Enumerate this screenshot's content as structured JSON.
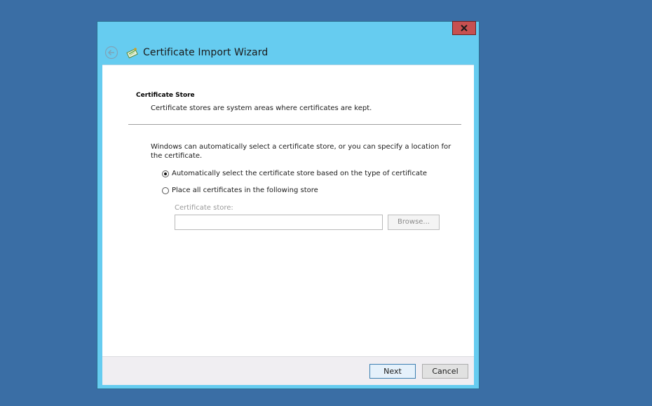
{
  "window": {
    "title": "Certificate Import Wizard",
    "close_label": "x"
  },
  "page": {
    "heading": "Certificate Store",
    "subheading": "Certificate stores are system areas where certificates are kept.",
    "intro": "Windows can automatically select a certificate store, or you can specify a location for the certificate.",
    "option_auto": "Automatically select the certificate store based on the type of certificate",
    "option_manual": "Place all certificates in the following store",
    "store_label": "Certificate store:",
    "store_value": "",
    "browse_label": "Browse...",
    "selected_option": "auto"
  },
  "footer": {
    "next_label": "Next",
    "cancel_label": "Cancel"
  },
  "colors": {
    "desktop": "#3a6ea5",
    "window_frame": "#66ccf0",
    "close_button": "#c75050"
  },
  "icons": {
    "back": "back-arrow-icon",
    "wizard": "certificate-icon",
    "close": "close-icon"
  }
}
